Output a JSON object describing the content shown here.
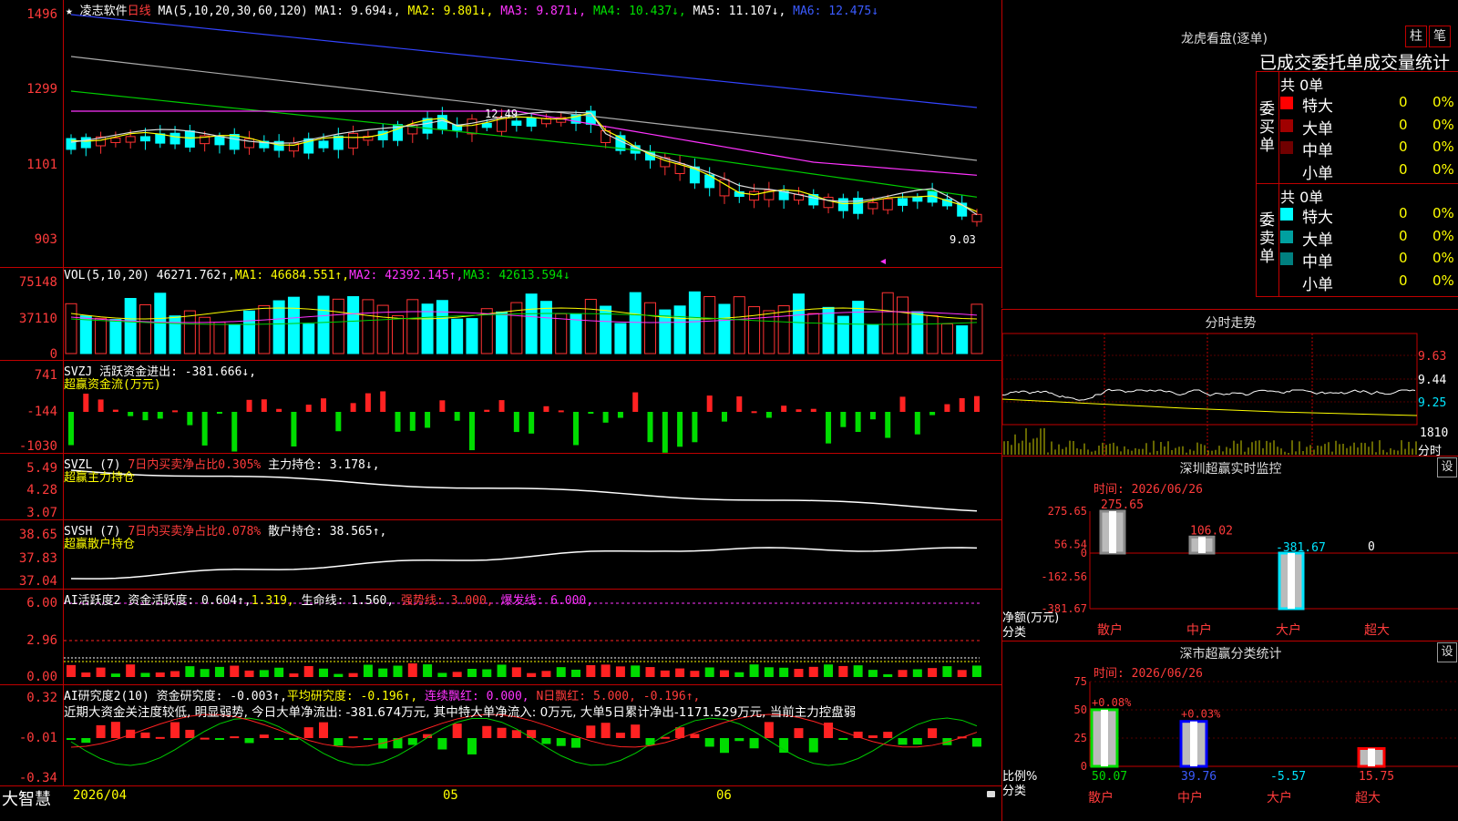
{
  "main": {
    "star": "★",
    "stock_name": "凌志软件",
    "period": "日线",
    "ma_label": "MA(5,10,20,30,60,120)",
    "ma1": "MA1: 9.694↓,",
    "ma2": "MA2: 9.801↓,",
    "ma3": "MA3: 9.871↓,",
    "ma4": "MA4: 10.437↓,",
    "ma5": "MA5: 11.107↓,",
    "ma6": "MA6: 12.475↓",
    "y_ticks": [
      "1496",
      "1299",
      "1101",
      "903"
    ],
    "hi_label": "12.49",
    "lo_label": "9.03"
  },
  "vol": {
    "label": "VOL(5,10,20)",
    "val": "46271.762↑,",
    "ma1": "MA1: 46684.551↑,",
    "ma2": "MA2: 42392.145↑,",
    "ma3": "MA3: 42613.594↓",
    "y_ticks": [
      "75148",
      "37110",
      "0"
    ]
  },
  "svzj": {
    "label": "SVZJ  活跃资金进出: -381.666↓,",
    "sub": "超赢资金流(万元)",
    "y_ticks": [
      "741",
      "-144",
      "-1030"
    ]
  },
  "svzl": {
    "label": "SVZL (7)",
    "pct": "7日内买卖净占比0.305%",
    "hold": "主力持仓: 3.178↓,",
    "sub": "超赢主力持仓",
    "y_ticks": [
      "5.49",
      "4.28",
      "3.07"
    ]
  },
  "svsh": {
    "label": "SVSH (7)",
    "pct": "7日内买卖净占比0.078%",
    "hold": "散户持仓: 38.565↑,",
    "sub": "超赢散户持仓",
    "y_ticks": [
      "38.65",
      "37.83",
      "37.04"
    ]
  },
  "ai1": {
    "label": "AI活跃度2",
    "a": "资金活跃度: 0.604↑,",
    "b": "1.319,",
    "c": "生命线: 1.560,",
    "d": "强势线: 3.000,",
    "e": "爆发线: 6.000,",
    "y_ticks": [
      "6.00",
      "2.96",
      "0.00"
    ]
  },
  "ai2": {
    "label": "AI研究度2(10)",
    "a": "资金研究度: -0.003↑,",
    "b": "平均研究度: -0.196↑,",
    "c": "连续飘红: 0.000,",
    "d": "N日飘红: 5.000,",
    "e": "-0.196↑,",
    "comment": "近期大资金关注度较低, 明显弱势, 今日大单净流出: -381.674万元, 其中特大单净流入: 0万元, 大单5日累计净出-1171.529万元, 当前主力控盘弱",
    "y_ticks": [
      "0.32",
      "-0.01",
      "-0.34"
    ]
  },
  "bottom": {
    "logo": "大智慧",
    "d1": "2026/04",
    "d2": "05",
    "d3": "06"
  },
  "lhb": {
    "title": "龙虎看盘(逐单)",
    "btn1": "柱",
    "btn2": "笔",
    "header": "已成交委托单成交量统计",
    "buy_title": "委买单",
    "sell_title": "委卖单",
    "buy_total": "共 0单",
    "sell_total": "共 0单",
    "buy_rows": [
      {
        "name": "特大",
        "qty": "0",
        "pct": "0%",
        "color": "#ff0000"
      },
      {
        "name": "大单",
        "qty": "0",
        "pct": "0%",
        "color": "#a00000"
      },
      {
        "name": "中单",
        "qty": "0",
        "pct": "0%",
        "color": "#700000"
      },
      {
        "name": "小单",
        "qty": "0",
        "pct": "0%",
        "color": ""
      }
    ],
    "sell_rows": [
      {
        "name": "特大",
        "qty": "0",
        "pct": "0%",
        "color": "#00ffff"
      },
      {
        "name": "大单",
        "qty": "0",
        "pct": "0%",
        "color": "#00a0a0"
      },
      {
        "name": "中单",
        "qty": "0",
        "pct": "0%",
        "color": "#008080"
      },
      {
        "name": "小单",
        "qty": "0",
        "pct": "0%",
        "color": ""
      }
    ]
  },
  "fs": {
    "title": "分时走势",
    "p1": "9.63",
    "p2": "9.44",
    "p3": "9.25",
    "v": "1810",
    "lbl": "分时"
  },
  "mon": {
    "title": "深圳超赢实时监控",
    "set": "设",
    "date": "时间: 2026/06/26",
    "y_ticks": [
      "275.65",
      "56.54",
      "0",
      "-162.56",
      "-381.67"
    ],
    "y_label1": "净额(万元)",
    "y_label2": "分类",
    "values": [
      275.65,
      106.02,
      -381.67,
      0
    ],
    "value_labels": [
      "275.65",
      "106.02",
      "-381.67",
      "0"
    ],
    "cats": [
      "散户",
      "中户",
      "大户",
      "超大"
    ]
  },
  "cls": {
    "title": "深市超赢分类统计",
    "set": "设",
    "date": "时间: 2026/06/26",
    "y_ticks": [
      "75",
      "50",
      "25",
      "0"
    ],
    "y_label1": "比例%",
    "y_label2": "分类",
    "values": [
      50.07,
      39.76,
      -5.57,
      15.75
    ],
    "value_labels": [
      "50.07",
      "39.76",
      "-5.57",
      "15.75"
    ],
    "top_labels": [
      "+0.08%",
      "+0.03%",
      "",
      ""
    ],
    "cats": [
      "散户",
      "中户",
      "大户",
      "超大"
    ],
    "colors": [
      "#00dd00",
      "#0000ff",
      "#ffffff",
      "#ff0000"
    ]
  }
}
